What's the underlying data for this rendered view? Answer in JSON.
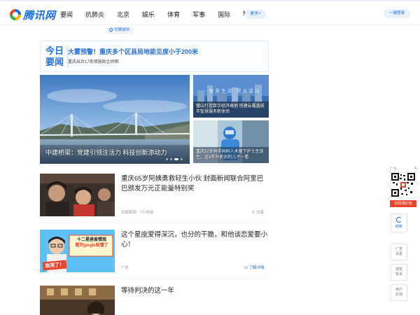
{
  "header": {
    "logo_text": "腾讯网",
    "nav": [
      "要闻",
      "抗肺炎",
      "北京",
      "娱乐",
      "体育",
      "军事",
      "国际",
      "NBA"
    ],
    "more_label": "更多+",
    "login_label": "一键登录",
    "city_label": "切换城市"
  },
  "today": {
    "label_line1": "今日",
    "label_line2": "要闻",
    "headline": "大雾预警！重庆多个区县局地能见度小于200米",
    "subline": "重庆出台17条措施助企纾困"
  },
  "hero": {
    "title": "中建桥梁：党建引领注活力 科技创新添动力"
  },
  "side_cards": [
    {
      "overlay": "智 慧 生 活 · 星 云 望 山",
      "caption": "璧山打造数字经济高地 搭建云覆盖城市智慧服务新体验"
    },
    {
      "caption": "重庆52岁妈手妈妈人术留下护士生涯生，这5年外卖员的儿子一看"
    }
  ],
  "feed": [
    {
      "title": "重庆65岁阿姨勇救轻生小伙 封面新闻联合阿里巴巴颁发万元正能量特别奖",
      "source": "封面新闻",
      "time": "7小时前",
      "action": "分享"
    },
    {
      "title": "这个星座爱得深沉，也分的干脆，和他谈恋爱要小心！",
      "source": "广告",
      "action": "了解详情",
      "thumb_banner": "十二星座爱情观",
      "thumb_banner2": "看完giegie就懂了",
      "thumb_stamp": "准哭了！"
    },
    {
      "title": "等待判决的这一年"
    }
  ],
  "right_rail": {
    "ad_label": "广告",
    "qr_button": "扫码领红包",
    "refresh": "刷新",
    "buttons": [
      {
        "line1": "广告",
        "line2": "设置"
      },
      {
        "line1": "侵权",
        "line2": "投诉"
      },
      {
        "line1": "用户",
        "line2": "反馈"
      }
    ]
  },
  "colors": {
    "brand_blue": "#2970d8",
    "red": "#e8442e"
  }
}
